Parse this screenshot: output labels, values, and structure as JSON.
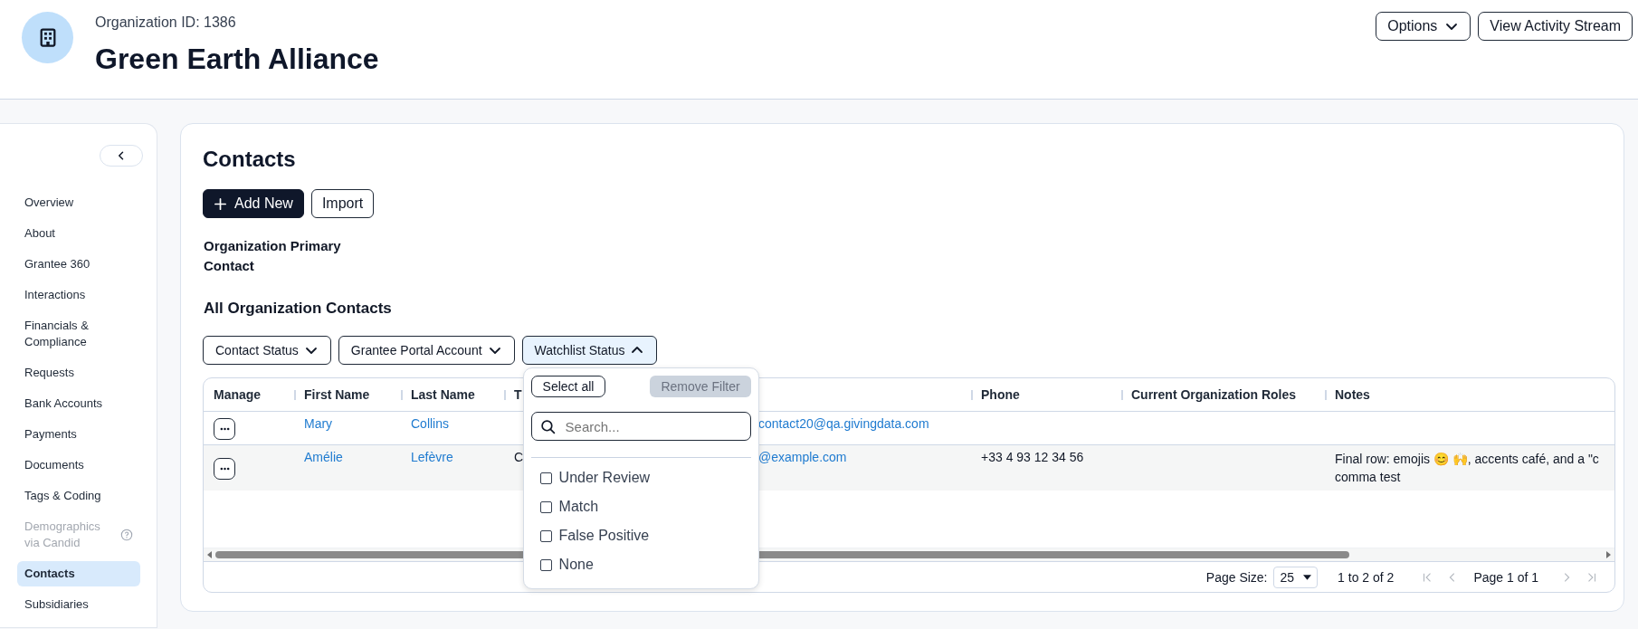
{
  "header": {
    "org_id": "Organization ID: 1386",
    "title": "Green Earth Alliance",
    "buttons": [
      {
        "label": "Options",
        "kind": "menu"
      },
      {
        "label": "View Activity Stream",
        "kind": "plain"
      }
    ]
  },
  "sidebar": {
    "items": [
      {
        "label": "Overview",
        "selected": false,
        "disabled": false
      },
      {
        "label": "About",
        "selected": false,
        "disabled": false
      },
      {
        "label": "Grantee 360",
        "selected": false,
        "disabled": false
      },
      {
        "label": "Interactions",
        "selected": false,
        "disabled": false
      },
      {
        "label": "Financials & Compliance",
        "selected": false,
        "disabled": false
      },
      {
        "label": "Requests",
        "selected": false,
        "disabled": false
      },
      {
        "label": "Bank Accounts",
        "selected": false,
        "disabled": false
      },
      {
        "label": "Payments",
        "selected": false,
        "disabled": false
      },
      {
        "label": "Documents",
        "selected": false,
        "disabled": false
      },
      {
        "label": "Tags & Coding",
        "selected": false,
        "disabled": false
      },
      {
        "label": "Demographics via Candid",
        "selected": false,
        "disabled": true,
        "help": true
      },
      {
        "label": "Contacts",
        "selected": true,
        "disabled": false
      },
      {
        "label": "Subsidiaries",
        "selected": false,
        "disabled": false
      }
    ]
  },
  "main": {
    "title": "Contacts",
    "actions": [
      {
        "label": "Add New",
        "kind": "primary"
      },
      {
        "label": "Import",
        "kind": "secondary"
      }
    ],
    "primary_contact_label": "Organization Primary Contact",
    "section_title": "All Organization Contacts",
    "filters": [
      {
        "label": "Contact Status",
        "expanded": false
      },
      {
        "label": "Grantee Portal Account",
        "expanded": false
      },
      {
        "label": "Watchlist Status",
        "expanded": true
      }
    ],
    "filter_menu": {
      "select_all": "Select all",
      "remove_filter": {
        "label": "Remove Filter",
        "disabled": true
      },
      "search": {
        "placeholder": "Search..."
      },
      "options": [
        {
          "label": "Under Review",
          "checked": false
        },
        {
          "label": "Match",
          "checked": false
        },
        {
          "label": "False Positive",
          "checked": false
        },
        {
          "label": "None",
          "checked": false
        }
      ]
    },
    "table": {
      "columns": [
        {
          "label": "Manage"
        },
        {
          "label": "First Name"
        },
        {
          "label": "Last Name"
        },
        {
          "label": "T"
        },
        {},
        {
          "label": "Phone"
        },
        {
          "label": "Current Organization Roles"
        },
        {
          "label": "Notes"
        }
      ],
      "rows": [
        {
          "first_name": "Mary",
          "last_name": "Collins",
          "column_5": "contact20@qa.givingdata.com"
        },
        {
          "first_name": "Amélie",
          "last_name": "Lefèvre",
          "column_4": "C",
          "column_5": "@example.com",
          "phone": "+33 4 93 12 34 56",
          "notes": "Final row: emojis 😊 🙌, accents café, and a \"c\ncomma test"
        }
      ]
    },
    "pagination": {
      "page_size_label": "Page Size:",
      "page_size": "25",
      "range": "1 to 2 of 2",
      "page": "Page 1 of 1",
      "nav": [
        {
          "kind": "first",
          "disabled": true
        },
        {
          "kind": "prev",
          "disabled": true
        },
        {
          "kind": "next",
          "disabled": true
        },
        {
          "kind": "last",
          "disabled": true
        }
      ]
    }
  }
}
